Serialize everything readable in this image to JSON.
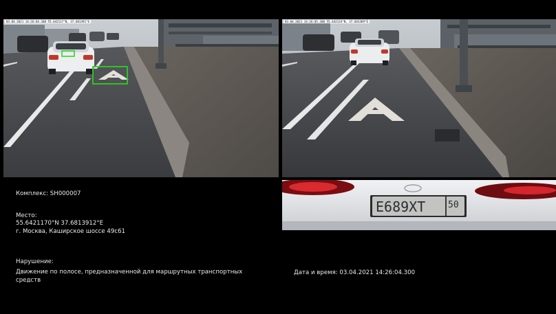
{
  "camera_left": {
    "timestamp_overlay": "03.04.2021 14:26:04.300 55.642117°N, 37.681391°E"
  },
  "camera_right": {
    "timestamp_overlay": "03.04.2021 14:26:05.300 55.642124°N, 37.681389°E"
  },
  "detection_box_color": "#2ad11f",
  "plate": {
    "number": "E689XT",
    "region": "50"
  },
  "info": {
    "complex": "Комплекс: SH000007",
    "place_label": "Место:",
    "coordinates": "55.6421170°N 37.6813912°E",
    "address": "г. Москва, Каширское шоссе 49с61",
    "violation_label": "Нарушение:",
    "violation_text": "Движение по полосе, предназначенной для маршрутных транспортных средств",
    "datetime": "Дата и время: 03.04.2021 14:26:04.300"
  }
}
